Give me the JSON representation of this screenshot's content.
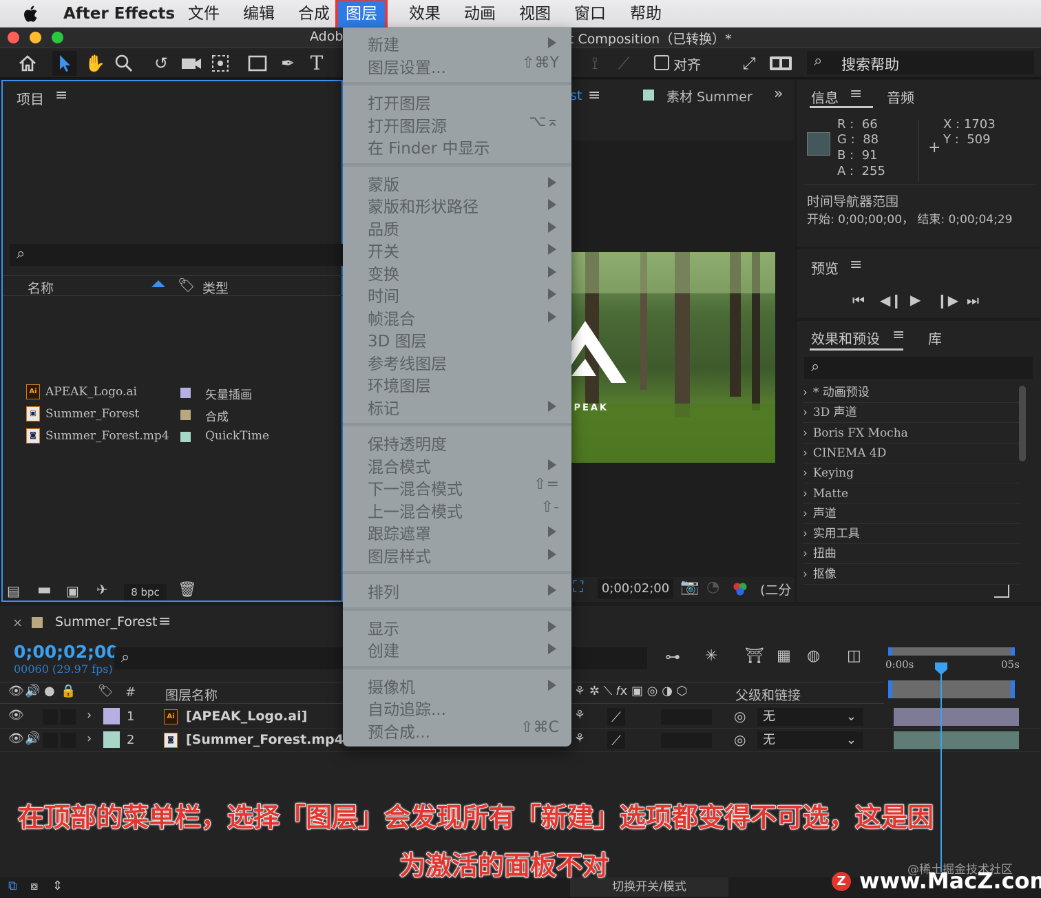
{
  "menubar": {
    "apple": "",
    "app_name": "After Effects",
    "items": [
      "文件",
      "编辑",
      "合成",
      "图层",
      "效果",
      "动画",
      "视图",
      "窗口",
      "帮助"
    ],
    "active": "图层"
  },
  "window": {
    "title_left": "Adob",
    "title_right": "t Composition（已转换）*"
  },
  "toolbar": {
    "align_label": "对齐",
    "search_help": "搜索帮助"
  },
  "project_panel": {
    "title": "项目",
    "columns": {
      "name": "名称",
      "type": "类型"
    },
    "items": [
      {
        "icon": "ai",
        "name": "APEAK_Logo.ai",
        "type": "矢量插画",
        "color": "#b5b0df"
      },
      {
        "icon": "comp",
        "name": "Summer_Forest",
        "type": "合成",
        "color": "#b9a77f"
      },
      {
        "icon": "video",
        "name": "Summer_Forest.mp4",
        "type": "QuickTime",
        "color": "#a7d6c9"
      }
    ],
    "footer": {
      "bpc": "8 bpc"
    }
  },
  "comp_viewer": {
    "tab_partial": "st",
    "footage_tab": "素材 Summer",
    "logo_text": "APEAK",
    "timecode": "0;00;02;00",
    "resolution": "(二分"
  },
  "info_panel": {
    "tabs": [
      "信息",
      "音频"
    ],
    "r": "66",
    "g": "88",
    "b": "91",
    "a": "255",
    "x": "1703",
    "y": "509",
    "swatch_color": "#42585b",
    "nav_title": "时间导航器范围",
    "nav_range": "开始: 0;00;00;00， 结束: 0;00;04;29"
  },
  "preview_panel": {
    "title": "预览"
  },
  "effects_panel": {
    "tabs": [
      "效果和预设",
      "库"
    ],
    "items": [
      "* 动画预设",
      "3D 声道",
      "Boris FX Mocha",
      "CINEMA 4D",
      "Keying",
      "Matte",
      "声道",
      "实用工具",
      "扭曲",
      "抠像"
    ]
  },
  "layer_menu": {
    "groups": [
      [
        {
          "label": "新建",
          "shortcut": "",
          "submenu": true
        },
        {
          "label": "图层设置...",
          "shortcut": "⇧⌘Y",
          "submenu": false
        }
      ],
      [
        {
          "label": "打开图层",
          "shortcut": "",
          "submenu": false
        },
        {
          "label": "打开图层源",
          "shortcut": "⌥⌅",
          "submenu": false
        },
        {
          "label": "在 Finder 中显示",
          "shortcut": "",
          "submenu": false
        }
      ],
      [
        {
          "label": "蒙版",
          "shortcut": "",
          "submenu": true
        },
        {
          "label": "蒙版和形状路径",
          "shortcut": "",
          "submenu": true
        },
        {
          "label": "品质",
          "shortcut": "",
          "submenu": true
        },
        {
          "label": "开关",
          "shortcut": "",
          "submenu": true
        },
        {
          "label": "变换",
          "shortcut": "",
          "submenu": true
        },
        {
          "label": "时间",
          "shortcut": "",
          "submenu": true
        },
        {
          "label": "帧混合",
          "shortcut": "",
          "submenu": true
        },
        {
          "label": "3D 图层",
          "shortcut": "",
          "submenu": false
        },
        {
          "label": "参考线图层",
          "shortcut": "",
          "submenu": false
        },
        {
          "label": "环境图层",
          "shortcut": "",
          "submenu": false
        },
        {
          "label": "标记",
          "shortcut": "",
          "submenu": true
        }
      ],
      [
        {
          "label": "保持透明度",
          "shortcut": "",
          "submenu": false
        },
        {
          "label": "混合模式",
          "shortcut": "",
          "submenu": true
        },
        {
          "label": "下一混合模式",
          "shortcut": "⇧=",
          "submenu": false
        },
        {
          "label": "上一混合模式",
          "shortcut": "⇧-",
          "submenu": false
        },
        {
          "label": "跟踪遮罩",
          "shortcut": "",
          "submenu": true
        },
        {
          "label": "图层样式",
          "shortcut": "",
          "submenu": true
        }
      ],
      [
        {
          "label": "排列",
          "shortcut": "",
          "submenu": true
        }
      ],
      [
        {
          "label": "显示",
          "shortcut": "",
          "submenu": true
        },
        {
          "label": "创建",
          "shortcut": "",
          "submenu": true
        }
      ],
      [
        {
          "label": "摄像机",
          "shortcut": "",
          "submenu": true
        },
        {
          "label": "自动追踪...",
          "shortcut": "",
          "submenu": false
        },
        {
          "label": "预合成...",
          "shortcut": "⇧⌘C",
          "submenu": false
        }
      ]
    ]
  },
  "timeline": {
    "comp_name": "Summer_Forest",
    "timecode": "0;00;02;00",
    "frame_info": "00060 (29.97 fps)",
    "columns": {
      "hash": "#",
      "layer_name": "图层名称",
      "parent": "父级和链接"
    },
    "layers": [
      {
        "num": "1",
        "name": "[APEAK_Logo.ai]",
        "color": "#b5b0df",
        "icon": "ai",
        "parent": "无",
        "bar_color": "#7d7b96",
        "has_audio": false
      },
      {
        "num": "2",
        "name": "[Summer_Forest.mp4]",
        "color": "#a7d6c9",
        "icon": "video",
        "parent": "无",
        "bar_color": "#5f7d76",
        "has_audio": true
      }
    ],
    "ruler": {
      "start": "0:00s",
      "end": "05s"
    },
    "footer": "切换开关/模式"
  },
  "overlay": {
    "caption_line1": "在顶部的菜单栏，选择「图层」会发现所有「新建」选项都变得不可选，这是因",
    "caption_line2": "为激活的面板不对",
    "watermark_small": "@稀土掘金技术社区",
    "watermark_logo": "Z",
    "watermark_big": "www.MacZ.com"
  },
  "colors": {
    "accent_blue": "#2f7ae5",
    "timecode_blue": "#3ca0f0",
    "caption_red": "#e3362f",
    "menu_bg": "#9aa2a6"
  }
}
